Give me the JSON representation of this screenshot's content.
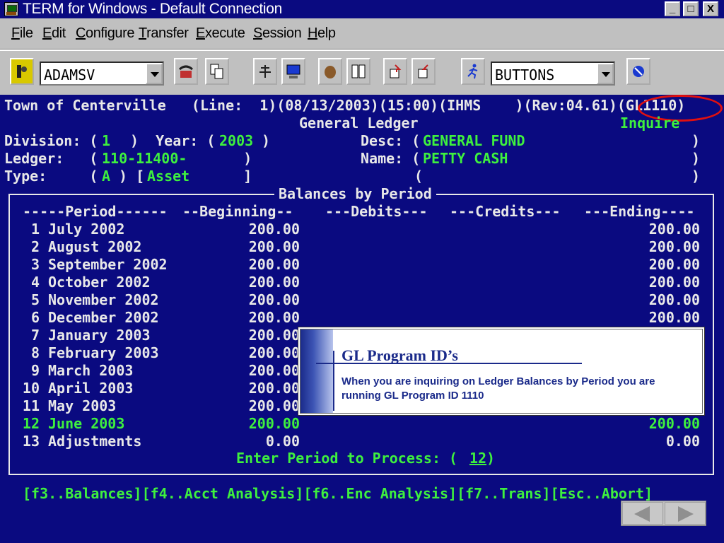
{
  "window": {
    "title": "TERM for Windows - Default Connection",
    "controls": [
      "_",
      "□",
      "X"
    ]
  },
  "menu": [
    "File",
    "Edit",
    "Configure",
    "Transfer",
    "Execute",
    "Session",
    "Help"
  ],
  "toolbar": {
    "user_combo": "ADAMSV",
    "buttons_combo": "BUTTONS"
  },
  "terminal": {
    "header": "Town of Centerville   (Line:  1)(08/13/2003)(15:00)(IHMS    )(Rev:04.61)(GL1110)",
    "subtitle": "General Ledger",
    "mode": "Inquire",
    "division_label": "Division: (",
    "division_value": "1",
    "year_label": ")  Year: (",
    "year_value": "2003",
    "year_close": " )",
    "desc_label": "Desc: (",
    "desc_value": "GENERAL FUND",
    "close_paren": ")",
    "ledger_label": "Ledger:   (",
    "ledger_value": "110-11400-",
    "ledger_close": "     )",
    "name_label": "Name: (",
    "name_value": "PETTY CASH",
    "type_label": "Type:     (",
    "type_value": "A",
    "type_mid": " ) [",
    "type_name": "Asset",
    "type_close": "      ]",
    "blank_open": "(",
    "section_title": "Balances by Period",
    "col_period": "-----Period------",
    "col_beginning": "--Beginning--",
    "col_debits": "---Debits---",
    "col_credits": "---Credits---",
    "col_ending": "---Ending----",
    "rows": [
      {
        "num": "1",
        "period": "July 2002",
        "beginning": "200.00",
        "ending": "200.00"
      },
      {
        "num": "2",
        "period": "August 2002",
        "beginning": "200.00",
        "ending": "200.00"
      },
      {
        "num": "3",
        "period": "September 2002",
        "beginning": "200.00",
        "ending": "200.00"
      },
      {
        "num": "4",
        "period": "October 2002",
        "beginning": "200.00",
        "ending": "200.00"
      },
      {
        "num": "5",
        "period": "November 2002",
        "beginning": "200.00",
        "ending": "200.00"
      },
      {
        "num": "6",
        "period": "December 2002",
        "beginning": "200.00",
        "ending": "200.00"
      },
      {
        "num": "7",
        "period": "January 2003",
        "beginning": "200.00",
        "ending": ""
      },
      {
        "num": "8",
        "period": "February 2003",
        "beginning": "200.00",
        "ending": ""
      },
      {
        "num": "9",
        "period": "March 2003",
        "beginning": "200.00",
        "ending": ""
      },
      {
        "num": "10",
        "period": "April 2003",
        "beginning": "200.00",
        "ending": ""
      },
      {
        "num": "11",
        "period": "May 2003",
        "beginning": "200.00",
        "ending": ""
      },
      {
        "num": "12",
        "period": "June 2003",
        "beginning": "200.00",
        "ending": "200.00"
      },
      {
        "num": "13",
        "period": "Adjustments",
        "beginning": "0.00",
        "ending": "0.00"
      }
    ],
    "prompt_label": "Enter Period to Process: (",
    "prompt_value": "12",
    "prompt_close": ")",
    "fkeys": "[f3..Balances][f4..Acct Analysis][f6..Enc Analysis][f7..Trans][Esc..Abort]"
  },
  "callout": {
    "title": "GL Program ID’s",
    "body": "When you are inquiring on Ledger Balances by Period you are running GL Program ID 1110"
  },
  "colors": {
    "terminal_bg": "#0a0a80",
    "terminal_fg": "#e8e8e8",
    "terminal_green": "#3ef03e",
    "highlight_circle": "#e01010",
    "callout_text": "#1a2a8a"
  }
}
